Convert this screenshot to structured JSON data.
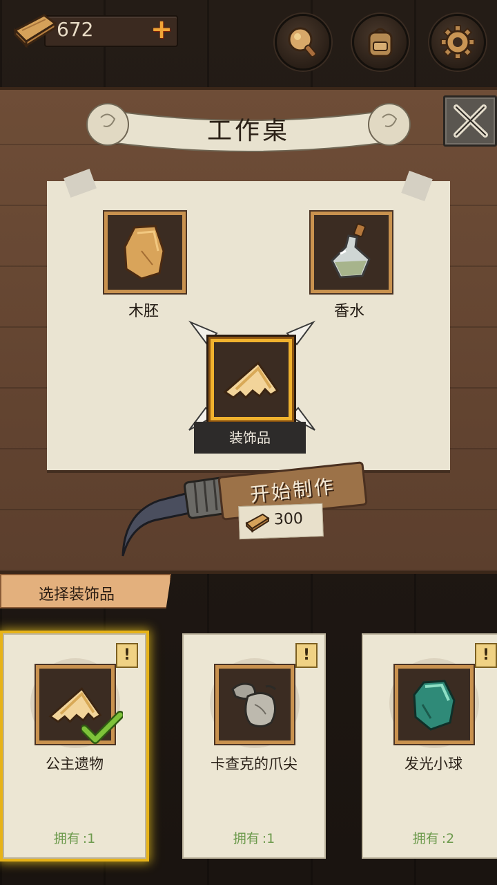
{
  "topbar": {
    "wood_count": "672",
    "plus_label": "+",
    "buttons": [
      {
        "icon": "rattle-icon"
      },
      {
        "icon": "backpack-icon"
      },
      {
        "icon": "gear-icon"
      }
    ]
  },
  "workbench": {
    "title": "工作桌",
    "slots": {
      "left_label": "木胚",
      "right_label": "香水",
      "center_label": "装饰品"
    },
    "start_button": "开始制作",
    "cost": "300"
  },
  "section_label": "选择装饰品",
  "items": [
    {
      "name": "公主遗物",
      "owned_label": "拥有",
      "owned_count": ":1",
      "warn": "!",
      "selected": true
    },
    {
      "name": "卡查克的爪尖",
      "owned_label": "拥有",
      "owned_count": ":1",
      "warn": "!",
      "selected": false
    },
    {
      "name": "发光小球",
      "owned_label": "拥有",
      "owned_count": ":2",
      "warn": "!",
      "selected": false
    }
  ],
  "colors": {
    "gold_frame": "#f0b22e",
    "owned_green": "#6c9a4c",
    "plus_orange": "#f0a437"
  }
}
